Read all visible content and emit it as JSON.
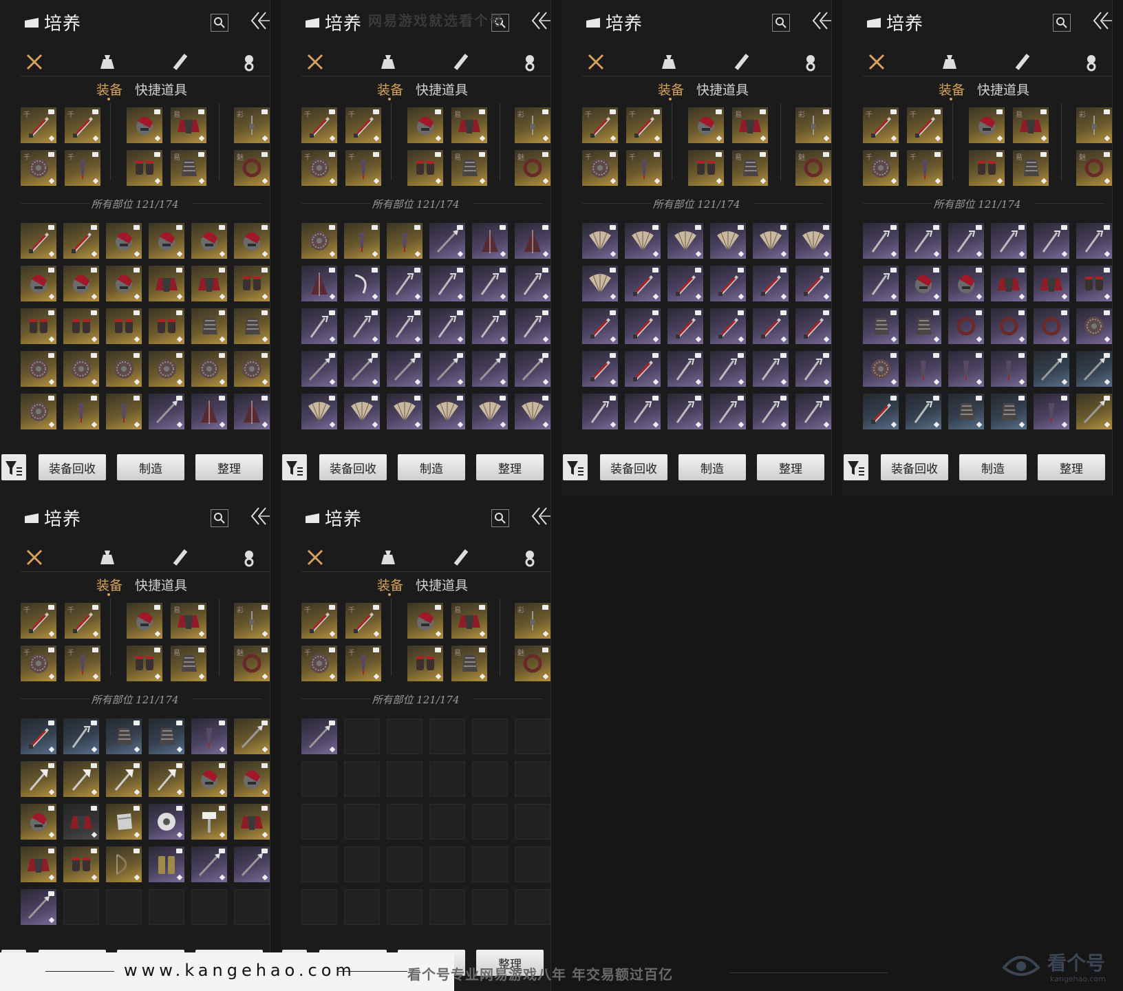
{
  "panel": {
    "title": "培养",
    "subtabs": [
      "装备",
      "快捷道具"
    ],
    "section_label": "所有部位 121/174",
    "buttons": [
      "装备回收",
      "制造",
      "整理"
    ]
  },
  "category_icons": [
    "crossed-swords-icon",
    "pouch-icon",
    "scroll-icon",
    "token-icon"
  ],
  "colors": {
    "accent": "#d8a25a",
    "gold": "#b59240",
    "purple": "#7a6a98",
    "blue": "#59708c"
  },
  "equipped": [
    {
      "item": "blade",
      "rarity": "gold",
      "mark": "千"
    },
    {
      "item": "blade",
      "rarity": "gold",
      "mark": "千"
    },
    {
      "item": "helmet",
      "rarity": "gold",
      "mark": ""
    },
    {
      "item": "armor",
      "rarity": "gold",
      "mark": "易"
    },
    {
      "item": "charm",
      "rarity": "gold",
      "mark": "彩"
    },
    {
      "item": "shield",
      "rarity": "gold",
      "mark": "千"
    },
    {
      "item": "dart",
      "rarity": "gold",
      "mark": "千"
    },
    {
      "item": "bracer",
      "rarity": "gold",
      "mark": ""
    },
    {
      "item": "gauntlet",
      "rarity": "gold",
      "mark": "易"
    },
    {
      "item": "ring",
      "rarity": "gold",
      "mark": "魅"
    }
  ],
  "panels": [
    {
      "grid": [
        "gold:blade",
        "gold:blade",
        "gold:helmet",
        "gold:helmet",
        "gold:helmet",
        "gold:helmet",
        "gold:helmet",
        "gold:helmet",
        "gold:helmet",
        "gold:armor",
        "gold:armor",
        "gold:bracer",
        "gold:bracer",
        "gold:bracer",
        "gold:bracer",
        "gold:bracer",
        "gold:gauntlet",
        "gold:gauntlet",
        "gold:shield",
        "gold:shield",
        "gold:shield",
        "gold:shield",
        "gold:shield",
        "gold:shield",
        "gold:shield",
        "gold:dart",
        "gold:dart",
        "purple:spear",
        "purple:umbrella",
        "purple:umbrella"
      ]
    },
    {
      "grid": [
        "gold:shield",
        "gold:dart",
        "gold:dart",
        "purple:spear",
        "purple:umbrella",
        "purple:umbrella",
        "purple:umbrella",
        "purple:sickle",
        "purple:fork",
        "purple:fork",
        "purple:fork",
        "purple:fork",
        "purple:fork",
        "purple:fork",
        "purple:fork",
        "purple:fork",
        "purple:fork",
        "purple:fork",
        "purple:spear",
        "purple:spear",
        "purple:spear",
        "purple:spear",
        "purple:spear",
        "purple:spear",
        "purple:fan",
        "purple:fan",
        "purple:fan",
        "purple:fan",
        "purple:fan",
        "purple:fan"
      ]
    },
    {
      "grid": [
        "purple:fan",
        "purple:fan",
        "purple:fan",
        "purple:fan",
        "purple:fan",
        "purple:fan",
        "purple:fan",
        "purple:blade",
        "purple:blade",
        "purple:blade",
        "purple:blade",
        "purple:blade",
        "purple:blade",
        "purple:blade",
        "purple:blade",
        "purple:blade",
        "purple:blade",
        "purple:blade",
        "purple:blade",
        "purple:blade",
        "purple:fork",
        "purple:fork",
        "purple:fork",
        "purple:fork",
        "purple:fork",
        "purple:fork",
        "purple:fork",
        "purple:fork",
        "purple:fork",
        "purple:fork"
      ]
    },
    {
      "grid": [
        "purple:fork",
        "purple:fork",
        "purple:fork",
        "purple:fork",
        "purple:fork",
        "purple:fork",
        "purple:fork",
        "purple:helmet",
        "purple:helmet",
        "purple:armor",
        "purple:armor",
        "purple:bracer",
        "purple:gauntlet",
        "purple:gauntlet",
        "purple:ring",
        "purple:ring",
        "purple:ring",
        "purple:shield",
        "purple:shield",
        "purple:dart",
        "purple:dart",
        "purple:dart",
        "blue:spear",
        "blue:spear",
        "blue:blade",
        "blue:fork",
        "blue:gauntlet",
        "blue:gauntlet",
        "purple:dart",
        "gold:spear"
      ]
    },
    {
      "grid": [
        "blue:blade",
        "blue:fork",
        "blue:gauntlet",
        "blue:gauntlet",
        "purple:dart",
        "gold:spear",
        "gold:glaive",
        "gold:glaive",
        "gold:glaive",
        "gold:glaive",
        "gold:helmet",
        "gold:helmet",
        "gold:helmet",
        "gray:armor",
        "gold:armguard",
        "purple:disc",
        "gold:hammer",
        "gold:armor",
        "gold:armor",
        "gold:bracer",
        "gold:bow",
        "purple:greaves",
        "purple:spear",
        "purple:spear",
        "purple:spear",
        "empty",
        "empty",
        "empty",
        "empty",
        "empty"
      ]
    },
    {
      "grid": [
        "purple:spear",
        "empty",
        "empty",
        "empty",
        "empty",
        "empty",
        "empty",
        "empty",
        "empty",
        "empty",
        "empty",
        "empty",
        "empty",
        "empty",
        "empty",
        "empty",
        "empty",
        "empty",
        "empty",
        "empty",
        "empty",
        "empty",
        "empty",
        "empty",
        "empty",
        "empty",
        "empty",
        "empty",
        "empty",
        "empty"
      ]
    }
  ],
  "footer": {
    "url": "www.kangehao.com",
    "slogan": "看个号专业网易游戏八年   年交易额过百亿",
    "logo_text": "看个号",
    "logo_sub": "kangehao.com",
    "watermark": "网易游戏就选看个号"
  }
}
